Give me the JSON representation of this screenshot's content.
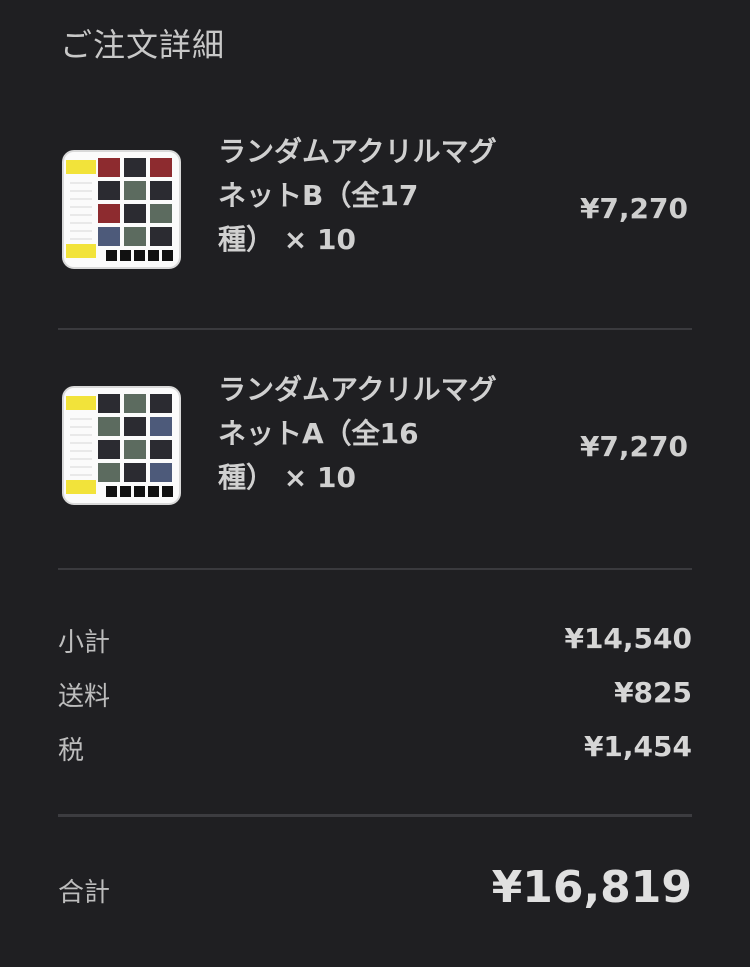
{
  "page": {
    "title": "ご注文詳細"
  },
  "items": [
    {
      "name": "ランダムアクリルマグネットB（全17種） × 10",
      "name_lines": [
        "ランダムアクリルマグ",
        "ネットB（全17",
        "種） × 10"
      ],
      "price": "¥7,270"
    },
    {
      "name": "ランダムアクリルマグネットA（全16種） × 10",
      "name_lines": [
        "ランダムアクリルマグ",
        "ネットA（全16",
        "種） × 10"
      ],
      "price": "¥7,270"
    }
  ],
  "summary": {
    "subtotal": {
      "label": "小計",
      "value": "¥14,540"
    },
    "shipping": {
      "label": "送料",
      "value": "¥825"
    },
    "tax": {
      "label": "税",
      "value": "¥1,454"
    }
  },
  "total": {
    "label": "合計",
    "value": "¥16,819"
  }
}
